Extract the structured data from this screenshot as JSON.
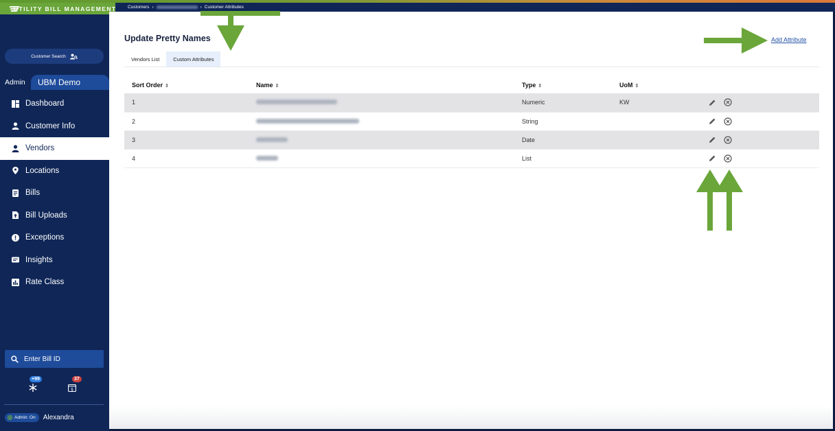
{
  "app": {
    "title": "UTILITY BILL MANAGEMENT"
  },
  "breadcrumb": {
    "first": "Customers",
    "separator": "›",
    "last": "Customer Attributes"
  },
  "sidebar": {
    "customer_search": "Customer Search",
    "admin_label": "Admin",
    "org_tab": "UBM Demo",
    "items": [
      {
        "label": "Dashboard",
        "icon": "dashboard-icon"
      },
      {
        "label": "Customer Info",
        "icon": "person-icon"
      },
      {
        "label": "Vendors",
        "icon": "person-icon"
      },
      {
        "label": "Locations",
        "icon": "location-pin-icon"
      },
      {
        "label": "Bills",
        "icon": "document-icon"
      },
      {
        "label": "Bill Uploads",
        "icon": "upload-icon"
      },
      {
        "label": "Exceptions",
        "icon": "exclamation-icon"
      },
      {
        "label": "Insights",
        "icon": "insights-icon"
      },
      {
        "label": "Rate Class",
        "icon": "bar-chart-icon"
      }
    ],
    "bill_id_placeholder": "Enter Bill ID",
    "badges": {
      "asterisk_count": "+99",
      "calendar_count": "37"
    },
    "admin_status": "Admin: On",
    "user_name": "Alexandra"
  },
  "main": {
    "title": "Update Pretty Names",
    "tabs": [
      {
        "label": "Vendors List"
      },
      {
        "label": "Custom Attributes"
      }
    ],
    "add_attribute": "Add Attribute",
    "table": {
      "headers": [
        "Sort Order",
        "Name",
        "Type",
        "UoM"
      ],
      "sort_glyph": "⇕",
      "rows": [
        {
          "sort": "1",
          "type": "Numeric",
          "uom": "KW"
        },
        {
          "sort": "2",
          "type": "String",
          "uom": ""
        },
        {
          "sort": "3",
          "type": "Date",
          "uom": ""
        },
        {
          "sort": "4",
          "type": "List",
          "uom": ""
        }
      ]
    }
  },
  "colors": {
    "sidebar": "#0f2657",
    "brand_green": "#6aa63a",
    "accent_blue": "#1e4b9a",
    "link": "#2351a3",
    "row_shade": "#e3e3e5",
    "annotation_arrow": "#6aa63a"
  }
}
